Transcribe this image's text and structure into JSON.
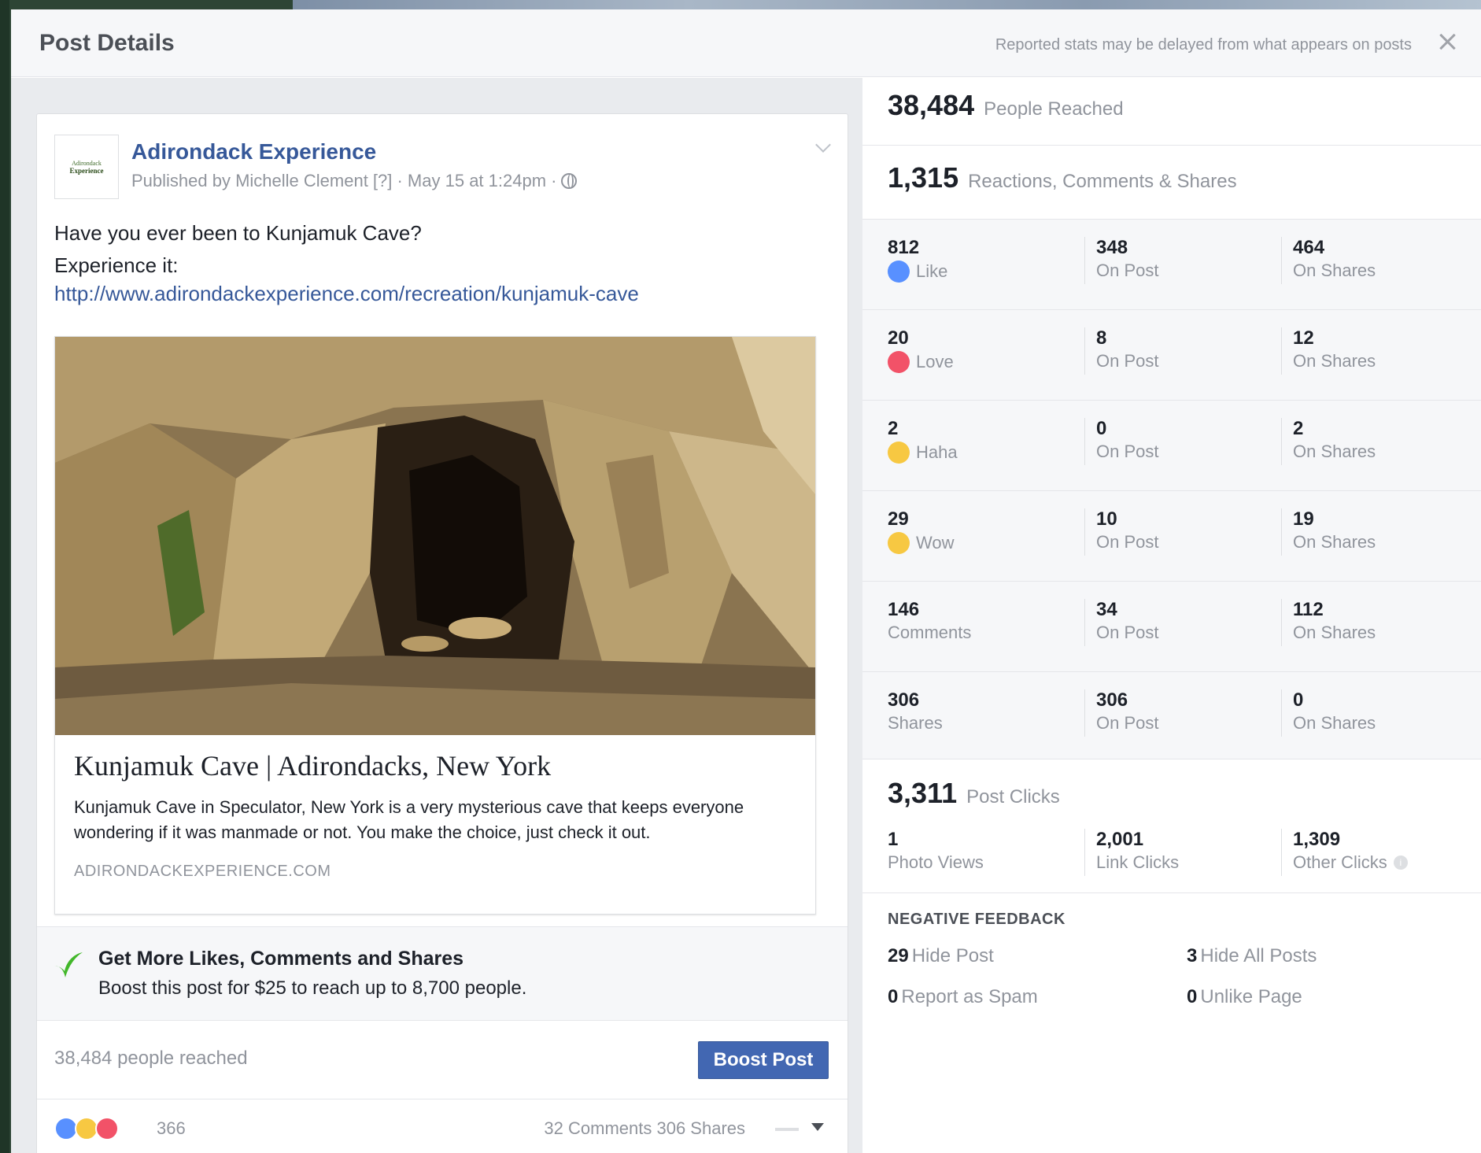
{
  "modal": {
    "title": "Post Details",
    "note": "Reported stats may be delayed from what appears on posts"
  },
  "post": {
    "logo_line1": "Adirondack",
    "logo_line2": "Experience",
    "page_name": "Adirondack Experience",
    "meta": "Published by Michelle Clement [?] · May 15 at 1:24pm ·",
    "line1": "Have you ever been to Kunjamuk Cave?",
    "line2": "Experience it:",
    "link": "http://www.adirondackexperience.com/recreation/kunjamuk-cave",
    "preview": {
      "title": "Kunjamuk Cave | Adirondacks, New York",
      "description": "Kunjamuk Cave in Speculator, New York is a very mysterious cave that keeps everyone wondering if it was manmade or not. You make the choice, just check it out.",
      "domain": "ADIRONDACKEXPERIENCE.COM"
    },
    "boost": {
      "headline": "Get More Likes, Comments and Shares",
      "text": "Boost this post for $25 to reach up to 8,700 people.",
      "reach": "38,484 people reached",
      "button": "Boost Post"
    },
    "footer": {
      "reaction_count": "366",
      "stats": "32 Comments  306 Shares"
    }
  },
  "stats": {
    "reached_num": "38,484",
    "reached_label": "People Reached",
    "engagement_num": "1,315",
    "engagement_label": "Reactions, Comments & Shares",
    "rows": [
      {
        "num": "812",
        "label": "Like",
        "post": "348",
        "post_label": "On Post",
        "shares": "464",
        "shares_label": "On Shares"
      },
      {
        "num": "20",
        "label": "Love",
        "post": "8",
        "post_label": "On Post",
        "shares": "12",
        "shares_label": "On Shares"
      },
      {
        "num": "2",
        "label": "Haha",
        "post": "0",
        "post_label": "On Post",
        "shares": "2",
        "shares_label": "On Shares"
      },
      {
        "num": "29",
        "label": "Wow",
        "post": "10",
        "post_label": "On Post",
        "shares": "19",
        "shares_label": "On Shares"
      },
      {
        "num": "146",
        "label": "Comments",
        "post": "34",
        "post_label": "On Post",
        "shares": "112",
        "shares_label": "On Shares"
      },
      {
        "num": "306",
        "label": "Shares",
        "post": "306",
        "post_label": "On Post",
        "shares": "0",
        "shares_label": "On Shares"
      }
    ],
    "clicks_num": "3,311",
    "clicks_label": "Post Clicks",
    "photo_views": "1",
    "photo_views_label": "Photo Views",
    "link_clicks": "2,001",
    "link_clicks_label": "Link Clicks",
    "other_clicks": "1,309",
    "other_clicks_label": "Other Clicks",
    "negative_title": "NEGATIVE FEEDBACK",
    "hide_post_num": "29",
    "hide_post_label": "Hide Post",
    "hide_all_num": "3",
    "hide_all_label": "Hide All Posts",
    "spam_num": "0",
    "spam_label": "Report as Spam",
    "unlike_num": "0",
    "unlike_label": "Unlike Page"
  }
}
